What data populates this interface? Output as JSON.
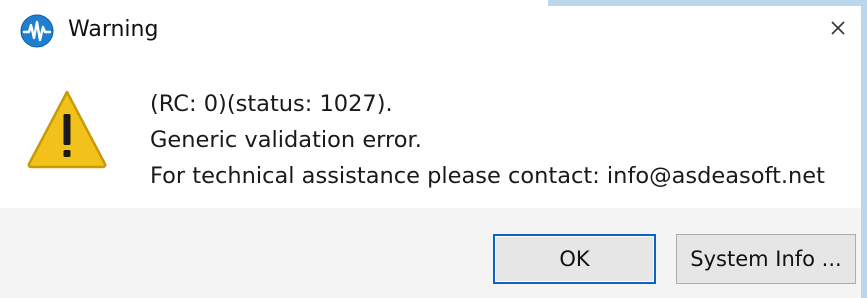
{
  "window": {
    "title": "Warning",
    "app_icon": "waveform-app-icon",
    "close_icon": "close-icon"
  },
  "dialog": {
    "icon": "warning-triangle-icon",
    "message_lines": [
      "(RC: 0)(status: 1027).",
      "Generic validation error.",
      "For technical assistance please contact: info@asdeasoft.net"
    ]
  },
  "buttons": {
    "ok_label": "OK",
    "system_info_label": "System Info ..."
  },
  "colors": {
    "app_icon": "#1e7fd0",
    "warning_fill": "#f2c21b",
    "warning_outline": "#c99a06",
    "default_button_border": "#0a64c8",
    "window_edge": "#bcd6ee"
  }
}
